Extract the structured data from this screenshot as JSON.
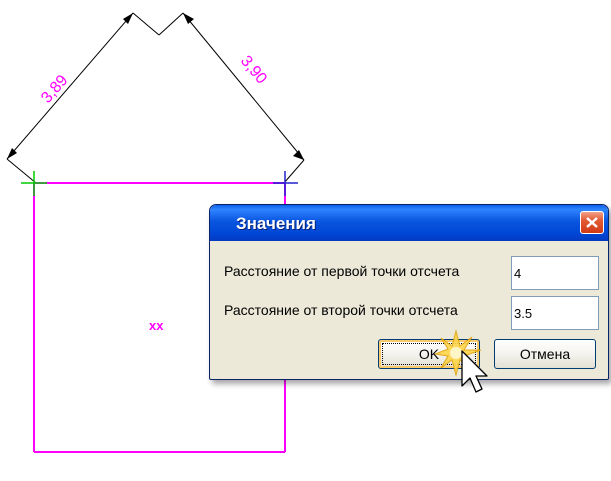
{
  "drawing": {
    "dimension_left_value": "3,89",
    "dimension_right_value": "3,90",
    "center_marker": "xx",
    "colors": {
      "outline": "#ff00ff",
      "dimension_text": "#ff00ff",
      "dimension_lines": "#000000",
      "point_marker_left": "#00cc00",
      "point_marker_right": "#2222cc"
    }
  },
  "dialog": {
    "title": "Значения",
    "close_icon": "close-x-icon",
    "field1_label": "Расстояние от первой точки отсчета",
    "field1_value": "4",
    "field2_label": "Расстояние от второй точки отсчета",
    "field2_value": "3.5",
    "ok_label": "OK",
    "cancel_label": "Отмена"
  },
  "cursor": {
    "icon": "arrow-pointer-icon",
    "effect": "click-highlight"
  }
}
